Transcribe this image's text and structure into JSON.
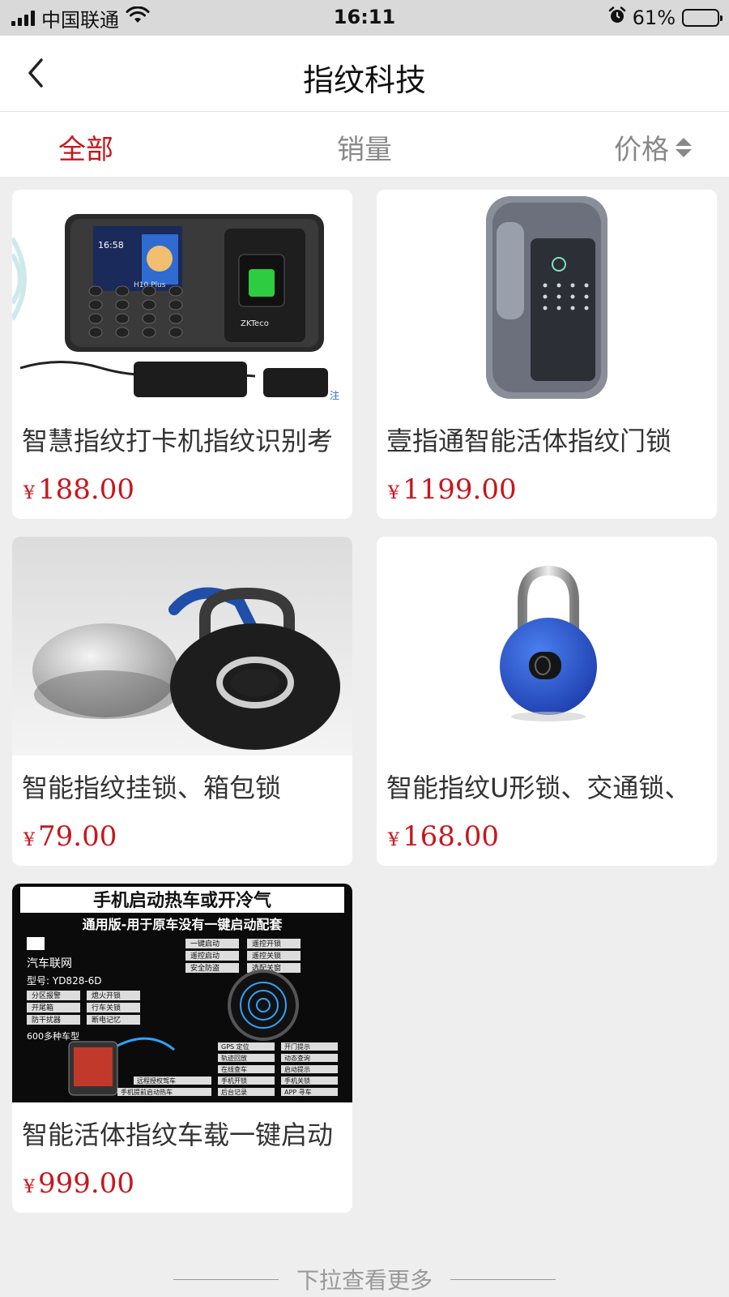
{
  "status_bar": {
    "carrier": "中国联通",
    "time": "16:11",
    "battery": "61%",
    "battery_level": 0.61
  },
  "nav": {
    "title": "指纹科技"
  },
  "filters": {
    "all": "全部",
    "sales": "销量",
    "price": "价格"
  },
  "products": [
    {
      "title": "智慧指纹打卡机指纹识别考",
      "currency": "¥",
      "price": "188.00",
      "image": "fingerprint-attendance-machine"
    },
    {
      "title": "壹指通智能活体指纹门锁",
      "currency": "¥",
      "price": "1199.00",
      "image": "fingerprint-door-lock"
    },
    {
      "title": "智能指纹挂锁、箱包锁",
      "currency": "¥",
      "price": "79.00",
      "image": "fingerprint-padlock-black"
    },
    {
      "title": "智能指纹U形锁、交通锁、",
      "currency": "¥",
      "price": "168.00",
      "image": "fingerprint-padlock-blue"
    },
    {
      "title": "智能活体指纹车载一键启动",
      "currency": "¥",
      "price": "999.00",
      "image": "car-one-key-start-poster"
    }
  ],
  "product_image_text": {
    "p1": {
      "model": "H10 Plus",
      "brand": "ZKTeco",
      "time_display": "16:58",
      "note": "注"
    },
    "p5": {
      "headline": "手机启动热车或开冷气",
      "subline": "通用版-用于原车没有一键启动配套",
      "brand": "汽车联网",
      "model": "型号: YD828-6D",
      "cars": "600多种车型",
      "tags_right_top": [
        "一键启动",
        "遥控开锁",
        "遥控启动",
        "遥控关锁",
        "安全防盗",
        "选配关窗"
      ],
      "tags_left": [
        "分区报警",
        "熄火开锁",
        "开尾箱",
        "行车关锁",
        "防干扰器",
        "断电记忆"
      ],
      "tags_right_bottom": [
        "GPS 定位",
        "开门提示",
        "轨迹回放",
        "动态查询",
        "在线查车",
        "启动提示",
        "手机开锁",
        "手机关锁",
        "后台记录",
        "APP 寻车"
      ],
      "tags_bottom_left": [
        "远程授权驾车",
        "手机提前启动热车"
      ]
    }
  },
  "footer": {
    "hint": "下拉查看更多"
  }
}
